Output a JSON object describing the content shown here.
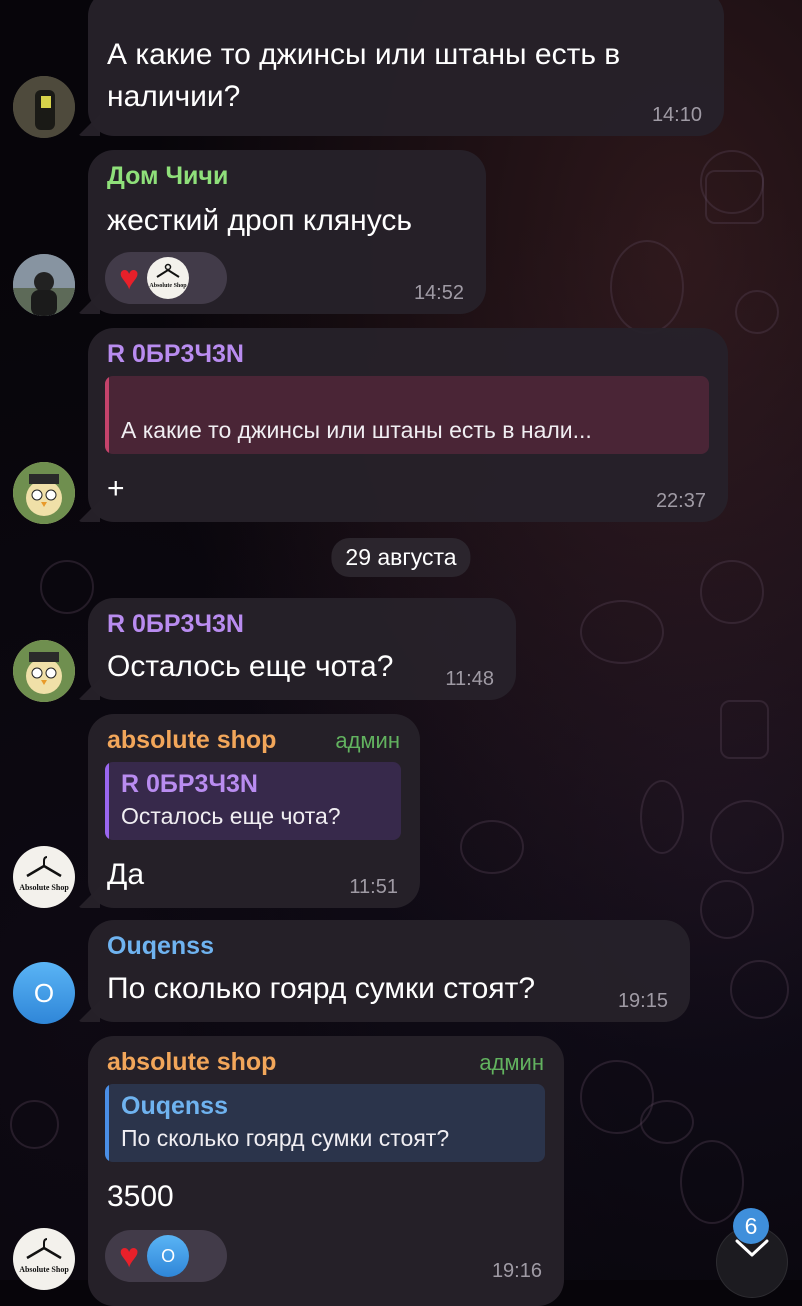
{
  "theme": {
    "accent_reply_pink": "#c4436b",
    "accent_reply_purple": "#9a66f0",
    "accent_reply_blue": "#4a8ee6",
    "admin_green": "#62b25f",
    "badge_blue": "#3f8fdb"
  },
  "messages": [
    {
      "text": "А какие то джинсы или штаны есть в\nналичии?",
      "time": "14:10"
    },
    {
      "sender": "Дом Чичи",
      "sender_color": "#8fe07a",
      "text": "жесткий дроп клянусь",
      "time": "14:52",
      "reactions": [
        "heart-icon",
        "absolute-shop-avatar"
      ]
    },
    {
      "sender": "R 0БР3Ч3N",
      "sender_color": "#b98cf0",
      "reply_text": "А какие то джинсы или штаны есть в нали...",
      "text": "+",
      "time": "22:37"
    },
    {
      "sender": "R 0БР3Ч3N",
      "sender_color": "#b98cf0",
      "text": "Осталось еще чота?",
      "time": "11:48"
    },
    {
      "sender": "absolute shop",
      "sender_color": "#f2a65a",
      "badge": "админ",
      "reply_name": "R 0БР3Ч3N",
      "reply_text": "Осталось еще чота?",
      "text": "Да",
      "time": "11:51"
    },
    {
      "sender": "Ouqenss",
      "sender_color": "#6fb3f0",
      "text": "По сколько гоярд сумки стоят?",
      "time": "19:15"
    },
    {
      "sender": "absolute shop",
      "sender_color": "#f2a65a",
      "badge": "админ",
      "reply_name": "Ouqenss",
      "reply_text": "По сколько гоярд сумки стоят?",
      "text": "3500",
      "time": "19:16",
      "reactions": [
        "heart-icon",
        "ouqenss-avatar"
      ]
    }
  ],
  "date_separator": "29 августа",
  "avatars": {
    "ouqenss_letter": "O",
    "shop_logo_text": "Absolute Shop"
  },
  "scroll_button": {
    "unread_count": "6",
    "icon": "chevron-down-icon"
  }
}
